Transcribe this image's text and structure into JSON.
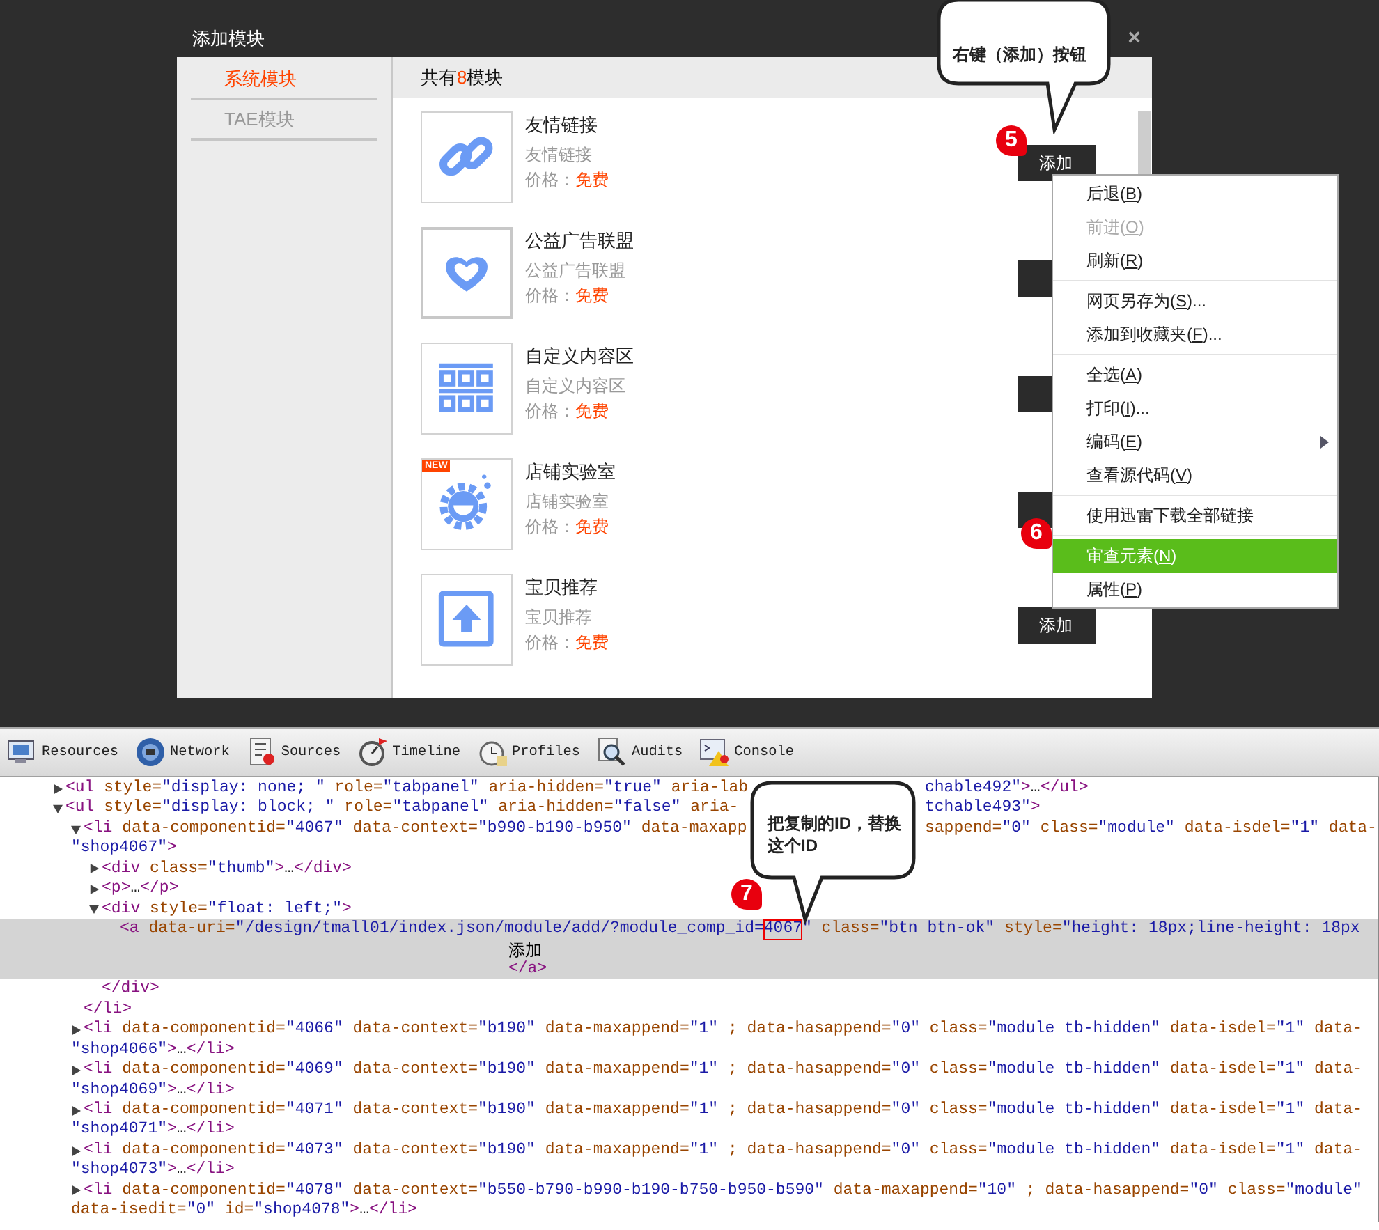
{
  "dialog": {
    "title": "添加模块",
    "close": "×",
    "sidebar": [
      {
        "label": "系统模块",
        "selected": true
      },
      {
        "label": "TAE模块",
        "selected": false
      }
    ],
    "header": {
      "prefix": "共有",
      "count": "8",
      "suffix": "模块"
    },
    "modules": [
      {
        "kind": "link",
        "highlighted": false,
        "name": "友情链接",
        "desc": "友情链接",
        "price_label": "价格：",
        "price": "免费",
        "button": "添加"
      },
      {
        "kind": "heart",
        "highlighted": true,
        "name": "公益广告联盟",
        "desc": "公益广告联盟",
        "price_label": "价格：",
        "price": "免费"
      },
      {
        "kind": "grid",
        "highlighted": false,
        "name": "自定义内容区",
        "desc": "自定义内容区",
        "price_label": "价格：",
        "price": "免费"
      },
      {
        "kind": "lab",
        "badge": "NEW",
        "highlighted": false,
        "name": "店铺实验室",
        "desc": "店铺实验室",
        "price_label": "价格：",
        "price": "免费"
      },
      {
        "kind": "upload",
        "highlighted": false,
        "name": "宝贝推荐",
        "desc": "宝贝推荐",
        "price_label": "价格：",
        "price": "免费",
        "button": "添加"
      }
    ]
  },
  "context_menu": {
    "groups": [
      [
        {
          "label": "后退(",
          "key": "B",
          "after": ")",
          "disabled": false,
          "selected": false,
          "submenu": false
        },
        {
          "label": "前进(",
          "key": "O",
          "after": ")",
          "disabled": true,
          "selected": false,
          "submenu": false
        },
        {
          "label": "刷新(",
          "key": "R",
          "after": ")",
          "disabled": false,
          "selected": false,
          "submenu": false
        }
      ],
      [
        {
          "label": "网页另存为(",
          "key": "S",
          "after": ")...",
          "disabled": false,
          "selected": false,
          "submenu": false
        },
        {
          "label": "添加到收藏夹(",
          "key": "F",
          "after": ")...",
          "disabled": false,
          "selected": false,
          "submenu": false
        }
      ],
      [
        {
          "label": "全选(",
          "key": "A",
          "after": ")",
          "disabled": false,
          "selected": false,
          "submenu": false
        },
        {
          "label": "打印(",
          "key": "I",
          "after": ")...",
          "disabled": false,
          "selected": false,
          "submenu": false
        },
        {
          "label": "编码(",
          "key": "E",
          "after": ")",
          "disabled": false,
          "selected": false,
          "submenu": true
        },
        {
          "label": "查看源代码(",
          "key": "V",
          "after": ")",
          "disabled": false,
          "selected": false,
          "submenu": false
        }
      ],
      [
        {
          "label": "使用迅雷下载全部链接",
          "disabled": false,
          "selected": false,
          "submenu": false
        }
      ],
      [
        {
          "label": "审查元素(",
          "key": "N",
          "after": ")",
          "disabled": false,
          "selected": true,
          "submenu": false
        },
        {
          "label": "属性(",
          "key": "P",
          "after": ")",
          "disabled": false,
          "selected": false,
          "submenu": false
        }
      ]
    ]
  },
  "annotations": {
    "right_click": {
      "step": "5",
      "lines": [
        "右键（添加）按钮"
      ]
    },
    "inspect": {
      "step": "6"
    },
    "replace_id": {
      "step": "7",
      "lines": [
        "把复制的ID，替换",
        "这个ID"
      ]
    }
  },
  "devtools": {
    "tabs": [
      {
        "label": "Resources",
        "kind": "resources"
      },
      {
        "label": "Network",
        "kind": "network"
      },
      {
        "label": "Sources",
        "kind": "sources"
      },
      {
        "label": "Timeline",
        "kind": "timeline"
      },
      {
        "label": "Profiles",
        "kind": "profiles"
      },
      {
        "label": "Audits",
        "kind": "audits"
      },
      {
        "label": "Console",
        "kind": "console"
      }
    ],
    "tree": [
      {
        "expanded": false,
        "selected": false,
        "head": "<ul style=\"display: none; \" role=\"tabpanel\" aria-hidden=\"true\" aria-lab",
        "after_gap": "chable492\">…</ul>"
      },
      {
        "expanded": true,
        "selected": false,
        "head": "<ul style=\"display: block; \" role=\"tabpanel\" aria-hidden=\"false\" aria-",
        "after_gap": "tchable493\">",
        "children": [
          {
            "expanded": true,
            "selected": false,
            "head": "<li data-componentid=\"4067\" data-context=\"b990-b190-b950\" data-maxapp",
            "after_gap": "sappend=\"0\" class=\"module\" data-isdel=\"1\" data-",
            "wrap": "\"shop4067\">",
            "close": "</li>",
            "children": [
              {
                "expanded": false,
                "selected": false,
                "head": "<div class=\"thumb\">…</div>"
              },
              {
                "expanded": false,
                "selected": false,
                "head": "<p>…</p>"
              },
              {
                "expanded": true,
                "selected": false,
                "head": "<div style=\"float: left;\">",
                "close": "</div>",
                "children": [
                  {
                    "selected": true,
                    "head": "<a data-uri=\"/design/tmall01/index.json/module/add/?module_comp_id=",
                    "boxed": "4067",
                    "rest": "\" class=\"btn btn-ok\" style=\"height: 18px;line-height: 18px",
                    "content": "添加",
                    "close": "</a>"
                  }
                ]
              }
            ]
          },
          {
            "expanded": false,
            "selected": false,
            "head": "<li data-componentid=\"4066\" data-context=\"b190\" data-maxappend=\"1\" ; data-hasappend=\"0\" class=\"module tb-hidden\" data-isdel=\"1\" data-",
            "wrap": "\"shop4066\">…</li>"
          },
          {
            "expanded": false,
            "selected": false,
            "head": "<li data-componentid=\"4069\" data-context=\"b190\" data-maxappend=\"1\" ; data-hasappend=\"0\" class=\"module tb-hidden\" data-isdel=\"1\" data-",
            "wrap": "\"shop4069\">…</li>"
          },
          {
            "expanded": false,
            "selected": false,
            "head": "<li data-componentid=\"4071\" data-context=\"b190\" data-maxappend=\"1\" ; data-hasappend=\"0\" class=\"module tb-hidden\" data-isdel=\"1\" data-",
            "wrap": "\"shop4071\">…</li>"
          },
          {
            "expanded": false,
            "selected": false,
            "head": "<li data-componentid=\"4073\" data-context=\"b190\" data-maxappend=\"1\" ; data-hasappend=\"0\" class=\"module tb-hidden\" data-isdel=\"1\" data-",
            "wrap": "\"shop4073\">…</li>"
          },
          {
            "expanded": false,
            "selected": false,
            "head": "<li data-componentid=\"4078\" data-context=\"b550-b790-b990-b190-b750-b950-b590\" data-maxappend=\"10\" ; data-hasappend=\"0\" class=\"module\"",
            "wrap": "data-isedit=\"0\" id=\"shop4078\">…</li>"
          }
        ]
      }
    ]
  }
}
